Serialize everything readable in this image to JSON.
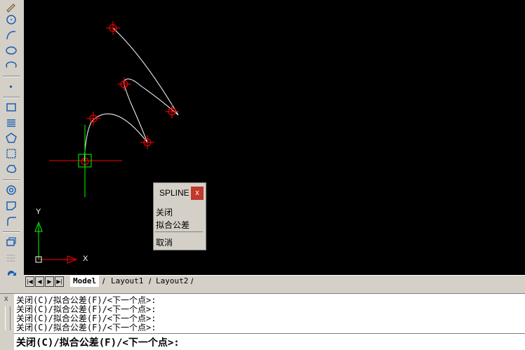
{
  "canvas": {
    "axis_y_label": "Y",
    "axis_x_label": "X"
  },
  "popup": {
    "title": "SPLINE",
    "close": "x",
    "items": [
      "关闭",
      "拟合公差",
      "取消"
    ]
  },
  "tabs": {
    "nav": [
      "|◀",
      "◀",
      "▶",
      "▶|"
    ],
    "model": "Model",
    "layout1": "Layout1",
    "layout2": "Layout2"
  },
  "command": {
    "history": [
      "关闭(C)/拟合公差(F)/<下一个点>:",
      "关闭(C)/拟合公差(F)/<下一个点>:",
      "关闭(C)/拟合公差(F)/<下一个点>:",
      "关闭(C)/拟合公差(F)/<下一个点>:"
    ],
    "prompt": "关闭(C)/拟合公差(F)/<下一个点>:",
    "close_icon": "x"
  },
  "colors": {
    "canvas_bg": "#000000",
    "spline": "#ffffff",
    "control_point": "#ff0000",
    "crosshair_h": "#ff0000",
    "crosshair_v": "#00ff00"
  }
}
